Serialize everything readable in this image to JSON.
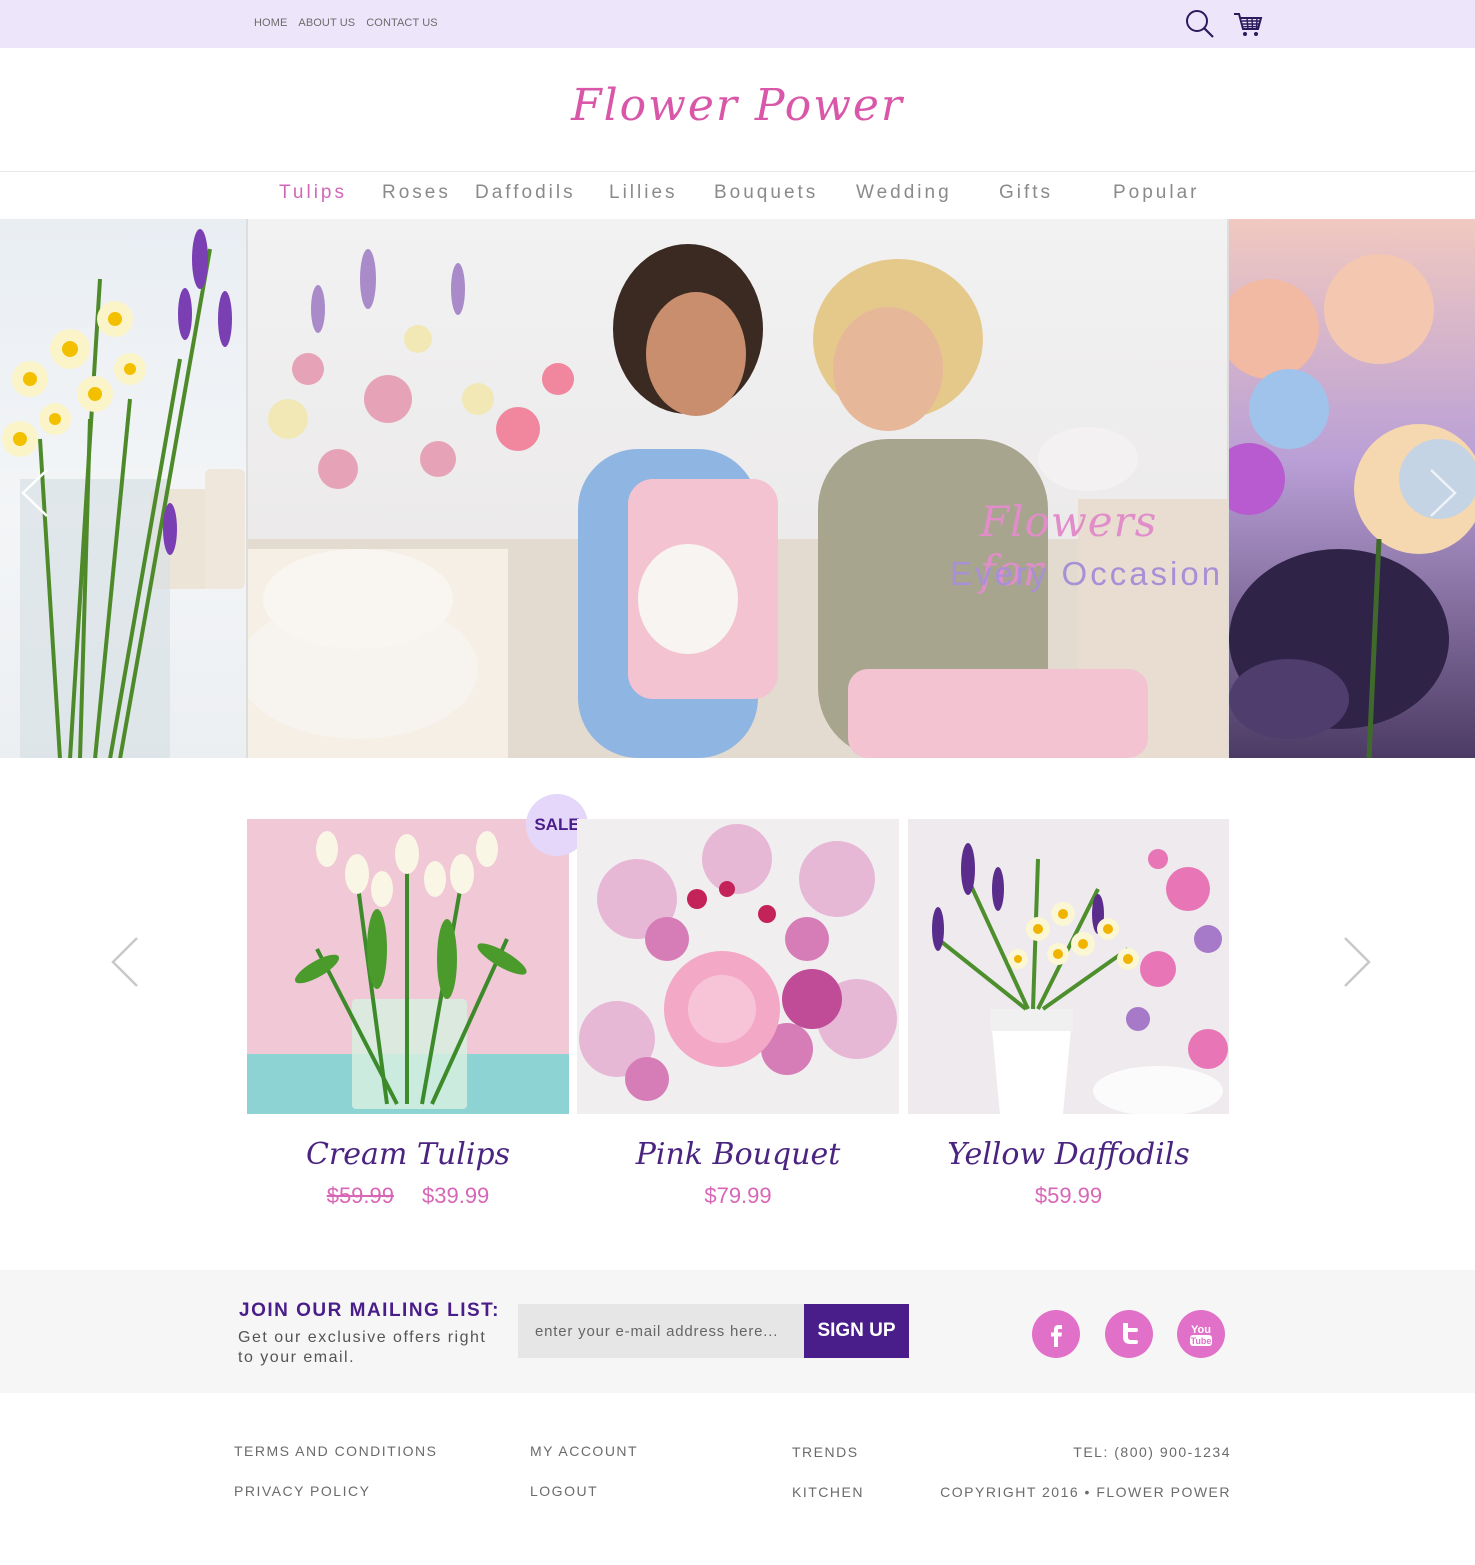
{
  "top_nav": {
    "links": [
      "HOME",
      "ABOUT US",
      "CONTACT US"
    ]
  },
  "icons": {
    "search": "search-icon",
    "cart": "cart-icon"
  },
  "brand": {
    "logo": "Flower Power"
  },
  "categories": [
    "Tulips",
    "Roses",
    "Daffodils",
    "Lillies",
    "Bouquets",
    "Wedding",
    "Gifts",
    "Popular"
  ],
  "active_category": "Tulips",
  "hero": {
    "title_script": "Flowers for",
    "title_main": "Every Occasion"
  },
  "products": [
    {
      "name": "Cream Tulips",
      "old_price": "$59.99",
      "price": "$39.99",
      "badge": "SALE"
    },
    {
      "name": "Pink Bouquet",
      "price": "$79.99"
    },
    {
      "name": "Yellow Daffodils",
      "price": "$59.99"
    }
  ],
  "mailing": {
    "title": "JOIN OUR MAILING LIST:",
    "subtitle": "Get our exclusive offers right to your email.",
    "placeholder": "enter your e-mail address here...",
    "button": "SIGN UP"
  },
  "social": [
    "facebook-icon",
    "twitter-icon",
    "youtube-icon"
  ],
  "footer": {
    "col1": [
      "TERMS AND CONDITIONS",
      "PRIVACY POLICY"
    ],
    "col2": [
      "MY ACCOUNT",
      "LOGOUT"
    ],
    "col3": [
      "TRENDS",
      "KITCHEN"
    ],
    "tel": "TEL: (800) 900-1234",
    "copyright": "COPYRIGHT 2016 •  FLOWER POWER"
  },
  "colors": {
    "topbar": "#ede6fb",
    "brand_pink": "#d957a8",
    "accent_purple": "#4a1e8a",
    "price_pink": "#d866b6",
    "social_pink": "#e170c8"
  }
}
